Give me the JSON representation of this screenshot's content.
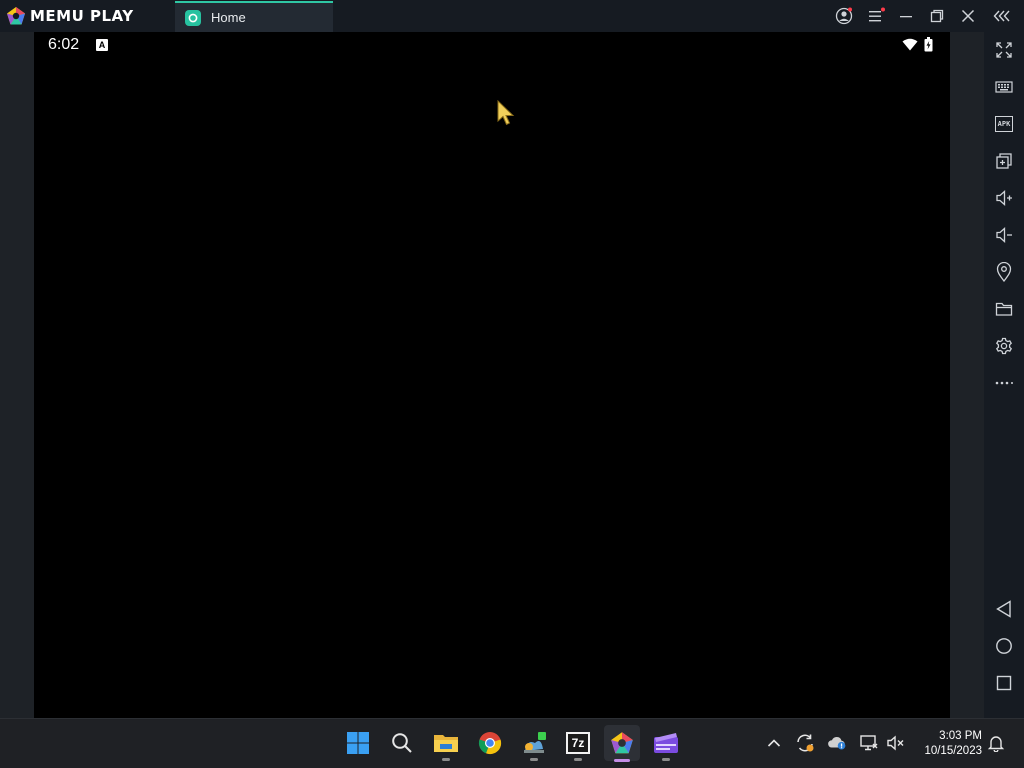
{
  "app": {
    "brand": "MEMU PLAY",
    "brand_accent": "#2fc7a4"
  },
  "tabs": [
    {
      "label": "Home",
      "active": true
    }
  ],
  "titlebar_controls": [
    "account-icon",
    "menu-icon",
    "minimize-icon",
    "restore-icon",
    "close-icon",
    "collapse-sidebar-icon"
  ],
  "android": {
    "status_time": "6:02",
    "status_badge": "A"
  },
  "sidebar": {
    "items": [
      "fullscreen-icon",
      "keyboard-icon",
      "apk-icon",
      "multi-instance-icon",
      "volume-up-icon",
      "volume-down-icon",
      "location-icon",
      "folder-icon",
      "settings-icon",
      "more-icon"
    ],
    "nav": [
      "back-icon",
      "home-icon",
      "recents-icon"
    ],
    "apk_label": "APK"
  },
  "taskbar": {
    "apps": [
      "start",
      "search",
      "file-explorer",
      "chrome",
      "app",
      "7zip",
      "memu",
      "clipchamp"
    ],
    "sevenzip_label": "7z",
    "time": "3:03 PM",
    "date": "10/15/2023"
  }
}
